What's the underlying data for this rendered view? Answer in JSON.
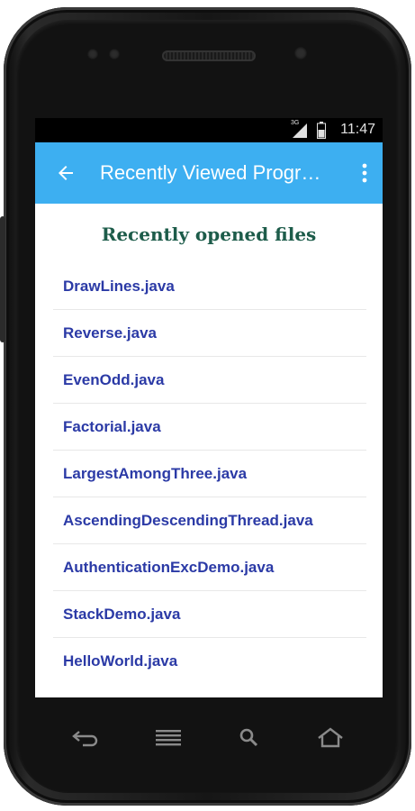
{
  "status_bar": {
    "network": "3G",
    "time": "11:47"
  },
  "app_bar": {
    "title": "Recently Viewed Progr…",
    "accent_color": "#3daff1",
    "back_icon": "arrow-left-icon",
    "overflow_icon": "more-vert-icon"
  },
  "main": {
    "heading": "Recently opened files",
    "files": [
      {
        "name": "DrawLines.java"
      },
      {
        "name": "Reverse.java"
      },
      {
        "name": "EvenOdd.java"
      },
      {
        "name": "Factorial.java"
      },
      {
        "name": "LargestAmongThree.java"
      },
      {
        "name": "AscendingDescendingThread.java"
      },
      {
        "name": "AuthenticationExcDemo.java"
      },
      {
        "name": "StackDemo.java"
      },
      {
        "name": "HelloWorld.java"
      }
    ]
  },
  "hardware_nav": {
    "buttons": [
      "back-icon",
      "menu-icon",
      "search-icon",
      "home-icon"
    ]
  }
}
